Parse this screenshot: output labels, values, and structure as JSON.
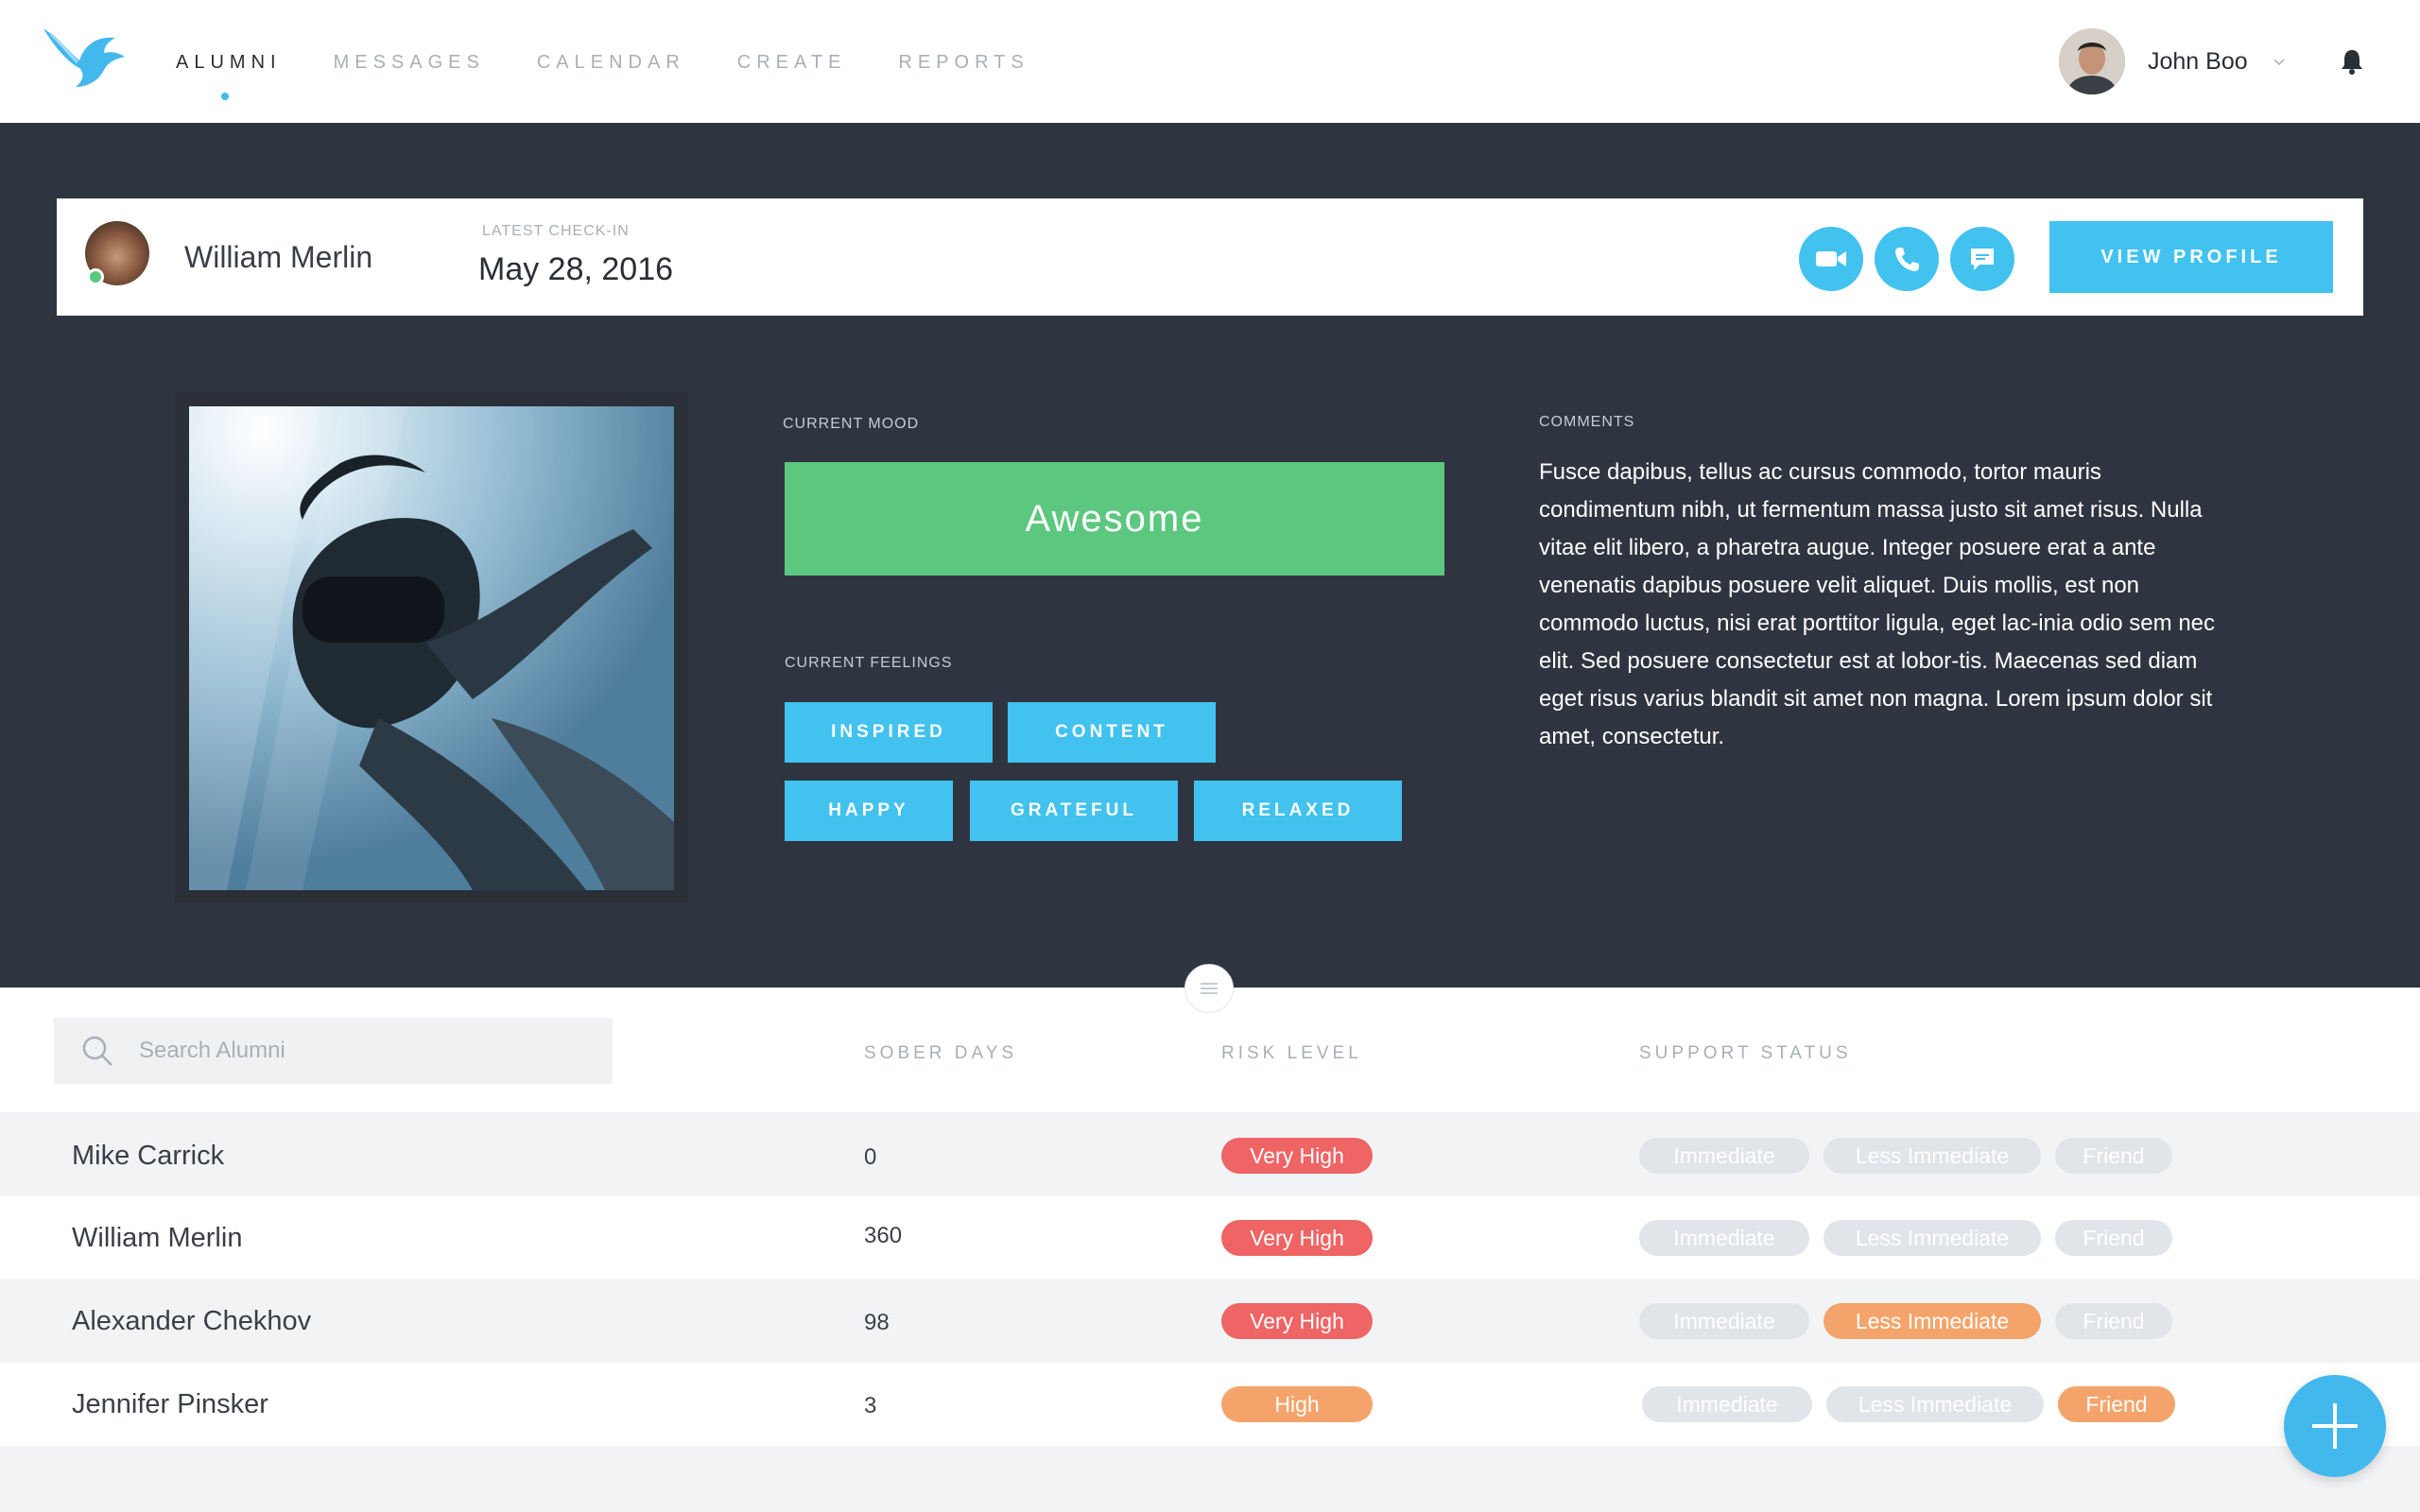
{
  "nav": {
    "items": [
      "ALUMNI",
      "MESSAGES",
      "CALENDAR",
      "CREATE",
      "REPORTS"
    ],
    "active": "ALUMNI"
  },
  "user": {
    "name": "John Boo"
  },
  "checkin": {
    "name": "William Merlin",
    "label": "LATEST CHECK-IN",
    "date": "May 28, 2016",
    "view_profile": "VIEW PROFILE"
  },
  "mood": {
    "label": "CURRENT MOOD",
    "value": "Awesome",
    "color": "#5cc77f"
  },
  "feelings": {
    "label": "CURRENT FEELINGS",
    "items": [
      "INSPIRED",
      "CONTENT",
      "HAPPY",
      "GRATEFUL",
      "RELAXED"
    ]
  },
  "comments": {
    "label": "COMMENTS",
    "text": "Fusce dapibus, tellus ac cursus commodo, tortor mauris condimentum nibh, ut fermentum massa justo sit amet risus. Nulla vitae elit libero, a pharetra augue. Integer posuere erat a ante venenatis dapibus posuere velit aliquet. Duis mollis, est non commodo luctus, nisi erat porttitor ligula, eget lac-inia odio sem nec elit. Sed posuere consectetur est at lobor-tis. Maecenas sed diam eget risus varius blandit sit amet non magna. Lorem ipsum dolor sit amet, consectetur."
  },
  "search": {
    "placeholder": "Search Alumni"
  },
  "columns": [
    "SOBER DAYS",
    "RISK LEVEL",
    "SUPPORT STATUS"
  ],
  "support_options": [
    "Immediate",
    "Less Immediate",
    "Friend"
  ],
  "rows": [
    {
      "name": "Mike Carrick",
      "sober_days": "0",
      "risk": "Very High",
      "support": ""
    },
    {
      "name": "William Merlin",
      "sober_days": "360",
      "risk": "Very High",
      "support": ""
    },
    {
      "name": "Alexander Chekhov",
      "sober_days": "98",
      "risk": "Very High",
      "support": "Less Immediate"
    },
    {
      "name": "Jennifer Pinsker",
      "sober_days": "3",
      "risk": "High",
      "support": "Friend"
    }
  ],
  "colors": {
    "accent": "#42c2ee",
    "very_high": "#ef6464",
    "high": "#f4a46a",
    "dark_bg": "#2f3540"
  }
}
